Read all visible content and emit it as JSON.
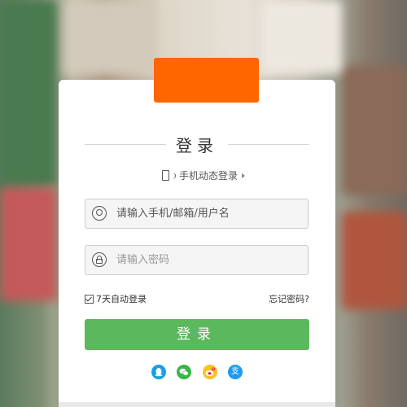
{
  "login": {
    "title": "登录",
    "dynamic_login_label": "手机动态登录",
    "username_placeholder": "请输入手机/邮箱/用户名",
    "password_placeholder": "请输入密码",
    "remember_label": "7天自动登录",
    "forgot_label": "忘记密码?",
    "submit_label": "登录",
    "remember_checked": true
  },
  "social": [
    {
      "name": "qq-icon",
      "glyph": "",
      "color": "#15a0e8"
    },
    {
      "name": "wechat-icon",
      "glyph": "",
      "color": "#39b54a"
    },
    {
      "name": "weibo-icon",
      "glyph": "",
      "color": "#f6c224"
    },
    {
      "name": "alipay-icon",
      "glyph": "支",
      "color": "#1e9bf0"
    }
  ],
  "colors": {
    "brand_orange": "#ff6600",
    "submit_green": "#5cb85c"
  }
}
